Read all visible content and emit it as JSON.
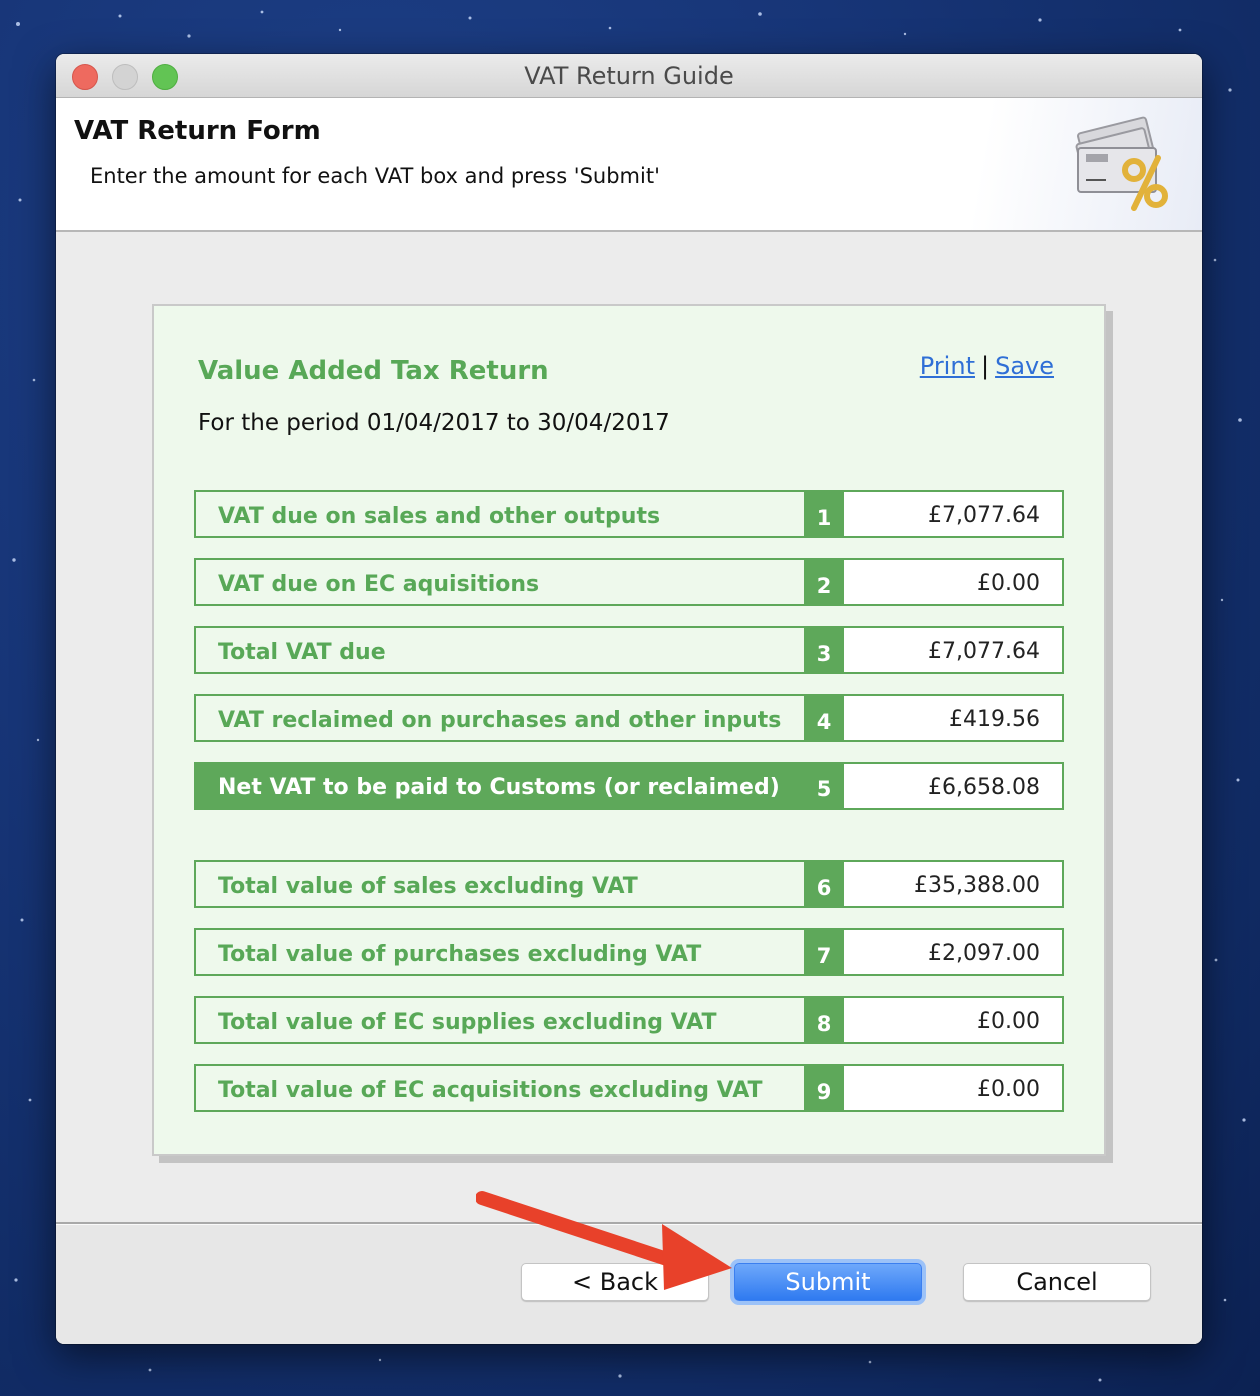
{
  "window": {
    "title": "VAT Return Guide",
    "controls": [
      "close",
      "minimize",
      "zoom"
    ]
  },
  "header": {
    "title": "VAT Return Form",
    "subtitle": "Enter the amount for each VAT box and press 'Submit'",
    "icon": "money-percent-icon"
  },
  "form": {
    "title": "Value Added Tax Return",
    "period": "For the period 01/04/2017 to 30/04/2017",
    "links": {
      "print": "Print",
      "separator": "|",
      "save": "Save"
    },
    "rows": [
      {
        "label": "VAT due on sales and other outputs",
        "box": "1",
        "value": "£7,077.64",
        "highlight": false
      },
      {
        "label": "VAT due on EC aquisitions",
        "box": "2",
        "value": "£0.00",
        "highlight": false
      },
      {
        "label": "Total VAT due",
        "box": "3",
        "value": "£7,077.64",
        "highlight": false
      },
      {
        "label": "VAT reclaimed on purchases and other inputs",
        "box": "4",
        "value": "£419.56",
        "highlight": false
      },
      {
        "label": "Net VAT to be paid to Customs (or reclaimed)",
        "box": "5",
        "value": "£6,658.08",
        "highlight": true
      },
      {
        "label": "Total value of sales excluding VAT",
        "box": "6",
        "value": "£35,388.00",
        "highlight": false
      },
      {
        "label": "Total value of purchases excluding VAT",
        "box": "7",
        "value": "£2,097.00",
        "highlight": false
      },
      {
        "label": "Total value of EC supplies excluding VAT",
        "box": "8",
        "value": "£0.00",
        "highlight": false
      },
      {
        "label": "Total value of EC acquisitions excluding VAT",
        "box": "9",
        "value": "£0.00",
        "highlight": false
      }
    ]
  },
  "footer": {
    "back_label": "< Back",
    "submit_label": "Submit",
    "cancel_label": "Cancel"
  },
  "annotation": {
    "arrow_color": "#e8412a",
    "points_to": "submit-button"
  },
  "colors": {
    "form_green": "#5ea85a",
    "form_background": "#eef9ec",
    "link_blue": "#2f6fd6",
    "submit_blue": "#2f7af0"
  }
}
